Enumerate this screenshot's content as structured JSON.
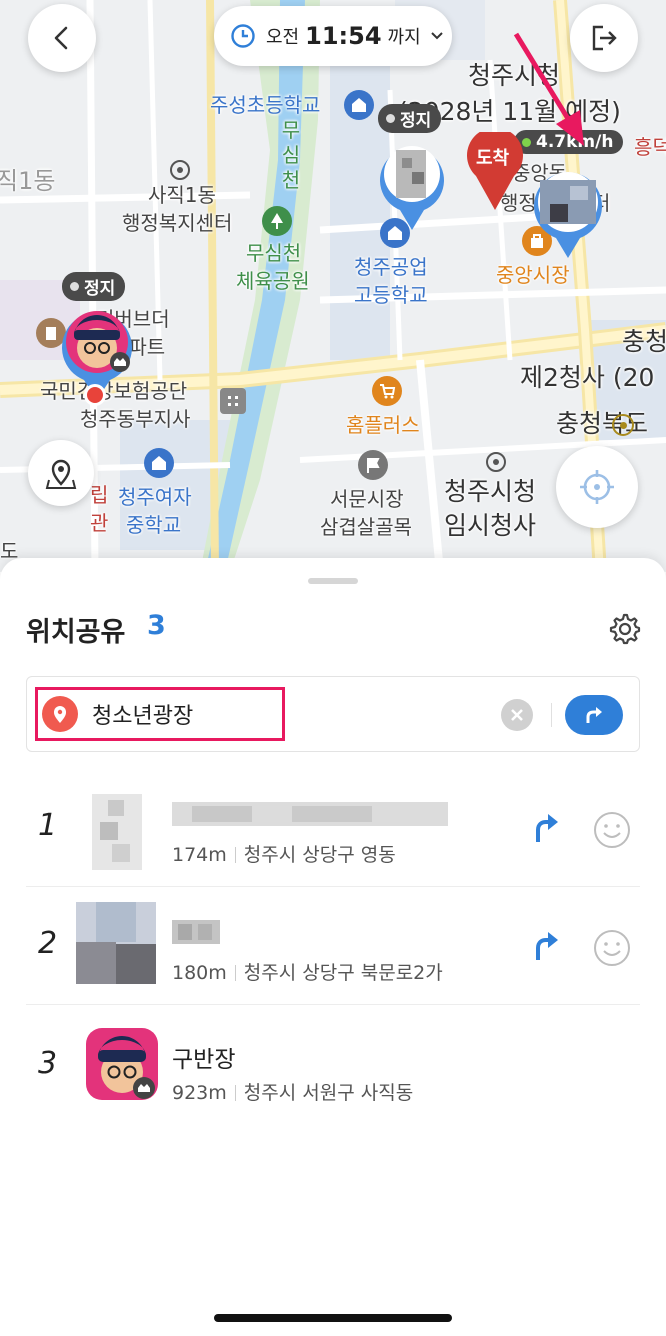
{
  "map": {
    "time_prefix": "오전",
    "time_value": "11:54",
    "time_suffix": "까지",
    "labels": {
      "city_hall": "청주시청",
      "city_hall_sub": "(2028년 11월 예정)",
      "juseong_school": "주성초등학교",
      "musimcheon": "무\n심\n천",
      "sajik_center_1": "사직1동",
      "sajik_center_2": "행정복지센터",
      "sajik_edge": "직1동",
      "sports_park_1": "무심천",
      "sports_park_2": "체육공원",
      "highschool_1": "청주공업",
      "highschool_2": "고등학교",
      "jungang_market": "중앙시장",
      "jungang_dong_1": "중앙동",
      "jungang_dong_2": "행정복지센터",
      "heungdeok": "흥덕",
      "apartment_1": "리버브더",
      "apartment_2": "아파트",
      "insurance": "국민건강보험공단",
      "cheongju_branch": "청주동부지사",
      "chungbuk_1": "충청",
      "second_office": "제2청사 (20",
      "chungbuk_do": "충청북도",
      "homeplus": "홈플러스",
      "girls_school_1": "청주여자",
      "girls_school_2": "중학교",
      "seomun_1": "서문시장",
      "seomun_2": "삼겹살골목",
      "temp_hall_1": "청주시청",
      "temp_hall_2": "임시청사",
      "left_edge_1": "립",
      "left_edge_2": "관",
      "left_edge_3": "도"
    },
    "tags": {
      "stop_1": "정지",
      "stop_2": "정지",
      "speed": "4.7km/h",
      "arrive": "도착"
    }
  },
  "sheet": {
    "title": "위치공유",
    "count": "3",
    "destination": "청소년광장",
    "members": [
      {
        "index": "1",
        "name": "",
        "distance": "174m",
        "address": "청주시 상당구 영동"
      },
      {
        "index": "2",
        "name": "",
        "distance": "180m",
        "address": "청주시 상당구 북문로2가"
      },
      {
        "index": "3",
        "name": "구반장",
        "distance": "923m",
        "address": "청주시 서원구 사직동"
      }
    ]
  },
  "colors": {
    "accent_blue": "#2f7fd8",
    "highlight_pink": "#e8195f",
    "marker_red": "#d23b33"
  }
}
